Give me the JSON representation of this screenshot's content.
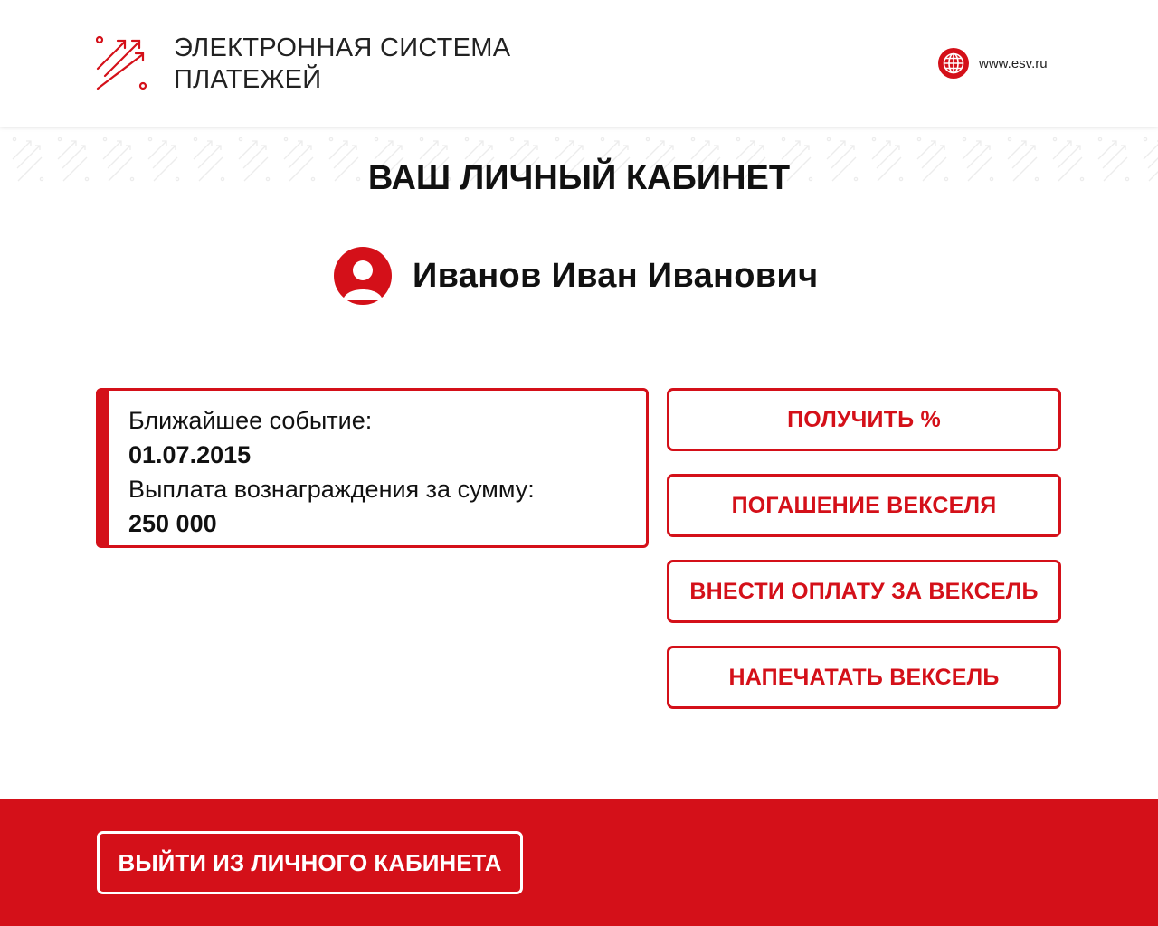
{
  "header": {
    "brand_line1": "ЭЛЕКТРОННАЯ СИСТЕМА",
    "brand_line2": "ПЛАТЕЖЕЙ",
    "site_url": "www.esv.ru"
  },
  "page_title": "ВАШ ЛИЧНЫЙ КАБИНЕТ",
  "user": {
    "full_name": "Иванов Иван Иванович"
  },
  "event": {
    "label": "Ближайшее событие:",
    "date": "01.07.2015",
    "description": "Выплата вознаграждения за сумму:",
    "amount": "250 000"
  },
  "actions": [
    {
      "label": "ПОЛУЧИТЬ %"
    },
    {
      "label": "ПОГАШЕНИЕ ВЕКСЕЛЯ"
    },
    {
      "label": "ВНЕСТИ ОПЛАТУ ЗА ВЕКСЕЛЬ"
    },
    {
      "label": "НАПЕЧАТАТЬ ВЕКСЕЛЬ"
    }
  ],
  "footer": {
    "logout_label": "ВЫЙТИ ИЗ ЛИЧНОГО КАБИНЕТА"
  },
  "colors": {
    "accent": "#d41019",
    "text": "#111111",
    "background": "#ffffff"
  },
  "icons": {
    "logo": "brand-arrows-logo",
    "site": "globe-icon",
    "user": "user-avatar-icon"
  }
}
